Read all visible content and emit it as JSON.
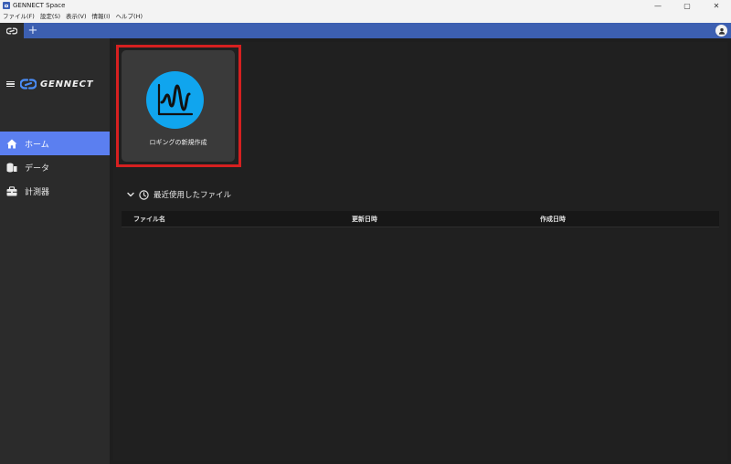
{
  "window": {
    "title": "GENNECT Space",
    "minimize_glyph": "—",
    "maximize_glyph": "▢",
    "close_glyph": "✕"
  },
  "menu": [
    {
      "label": "ファイル(F)"
    },
    {
      "label": "設定(S)"
    },
    {
      "label": "表示(V)"
    },
    {
      "label": "情報(I)"
    },
    {
      "label": "ヘルプ(H)"
    }
  ],
  "tabs": {
    "add_label": "+",
    "active_icon": "gennect-link-icon"
  },
  "brand": {
    "name": "GENNECT"
  },
  "nav": [
    {
      "label": "ホーム",
      "icon": "home-icon",
      "active": true
    },
    {
      "label": "データ",
      "icon": "data-icon",
      "active": false
    },
    {
      "label": "計測器",
      "icon": "instrument-icon",
      "active": false
    }
  ],
  "main": {
    "new_logging_tile": {
      "label": "ロギングの新規作成",
      "icon": "waveform-chart-icon"
    },
    "recent": {
      "title": "最近使用したファイル",
      "columns": [
        "ファイル名",
        "更新日時",
        "作成日時"
      ],
      "rows": []
    }
  },
  "colors": {
    "accent_blue": "#5b7ff0",
    "tab_bar": "#3c5fb1",
    "tile_icon": "#10a5ee",
    "highlight": "#d62020"
  }
}
